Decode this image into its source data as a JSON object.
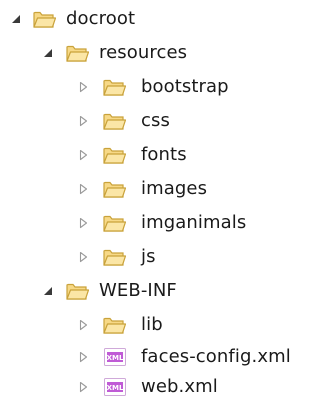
{
  "tree": {
    "docroot": {
      "label": "docroot",
      "expanded": true,
      "icon": "folder-icon"
    },
    "resources": {
      "label": "resources",
      "expanded": true,
      "icon": "folder-icon"
    },
    "bootstrap": {
      "label": "bootstrap",
      "expanded": false,
      "icon": "folder-icon"
    },
    "css": {
      "label": "css",
      "expanded": false,
      "icon": "folder-icon"
    },
    "fonts": {
      "label": "fonts",
      "expanded": false,
      "icon": "folder-icon"
    },
    "images": {
      "label": "images",
      "expanded": false,
      "icon": "folder-icon"
    },
    "imganimals": {
      "label": "imganimals",
      "expanded": false,
      "icon": "folder-icon"
    },
    "js": {
      "label": "js",
      "expanded": false,
      "icon": "folder-icon"
    },
    "webinf": {
      "label": "WEB-INF",
      "expanded": true,
      "icon": "folder-icon"
    },
    "lib": {
      "label": "lib",
      "expanded": false,
      "icon": "folder-icon"
    },
    "faces_config": {
      "label": "faces-config.xml",
      "icon": "xml-file-icon",
      "icon_text": "XML"
    },
    "web_xml": {
      "label": "web.xml",
      "icon": "xml-file-icon",
      "icon_text": "XML"
    }
  },
  "colors": {
    "folder_fill": "#f7d987",
    "folder_outline": "#c9a23a",
    "xml_fill": "#c05bd6",
    "twisty_expanded": "#3a3a3a",
    "twisty_collapsed": "#9a9a9a"
  }
}
